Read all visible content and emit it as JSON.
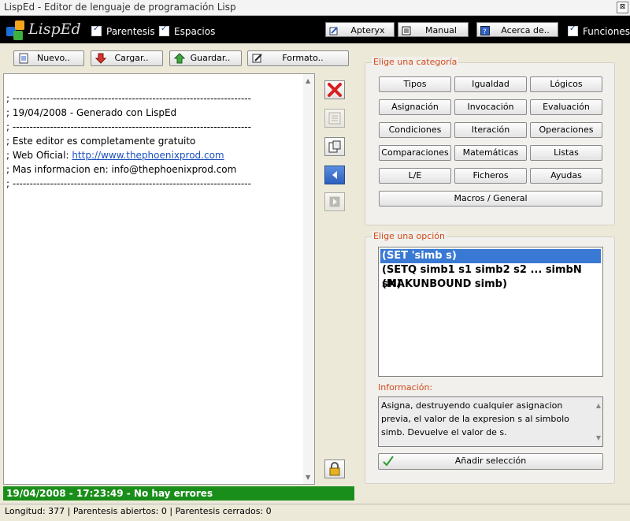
{
  "window": {
    "title": "LispEd - Editor de lenguaje de programación Lisp",
    "close": "⊠"
  },
  "logo": {
    "text": "LispEd"
  },
  "toolbar": {
    "parentesis": "Parentesis",
    "espacios": "Espacios",
    "apteryx": "Apteryx",
    "manual": "Manual",
    "acerca": "Acerca de..",
    "funciones": "Funciones"
  },
  "actions": {
    "nuevo": "Nuevo..",
    "cargar": "Cargar..",
    "guardar": "Guardar..",
    "formato": "Formato.."
  },
  "editor": {
    "lines": [
      "; ----------------------------------------------------------------------",
      "; 19/04/2008 - Generado con LispEd",
      "; ----------------------------------------------------------------------",
      "; Este editor es completamente gratuito",
      "; Web Oficial: ",
      "; Mas informacion en: info@thephoenixprod.com",
      "; ----------------------------------------------------------------------"
    ],
    "link": "http://www.thephoenixprod.com"
  },
  "categories": {
    "label": "Elige una categoría",
    "items": [
      "Tipos",
      "Igualdad",
      "Lógicos",
      "Asignación",
      "Invocación",
      "Evaluación",
      "Condiciones",
      "Iteración",
      "Operaciones",
      "Comparaciones",
      "Matemáticas",
      "Listas",
      "L/E",
      "Ficheros",
      "Ayudas"
    ],
    "macros": "Macros / General"
  },
  "options": {
    "label": "Elige una opción",
    "items": [
      "(SET 'simb s)",
      "(SETQ simb1 s1 simb2 s2 ... simbN sN)",
      "(MAKUNBOUND simb)"
    ]
  },
  "info": {
    "label": "Información:",
    "text": "Asigna, destruyendo cualquier asignacion previa, el valor de la expresion s al simbolo simb. Devuelve el valor de s."
  },
  "add_selection": "Añadir selección",
  "status": "19/04/2008 - 17:23:49 - No hay errores",
  "footer": "Longitud: 377  |  Parentesis abiertos: 0  |  Parentesis cerrados: 0",
  "colors": {
    "status_green": "#1a8e1a",
    "selection": "#3979d4",
    "group_label": "#d24a1a"
  }
}
